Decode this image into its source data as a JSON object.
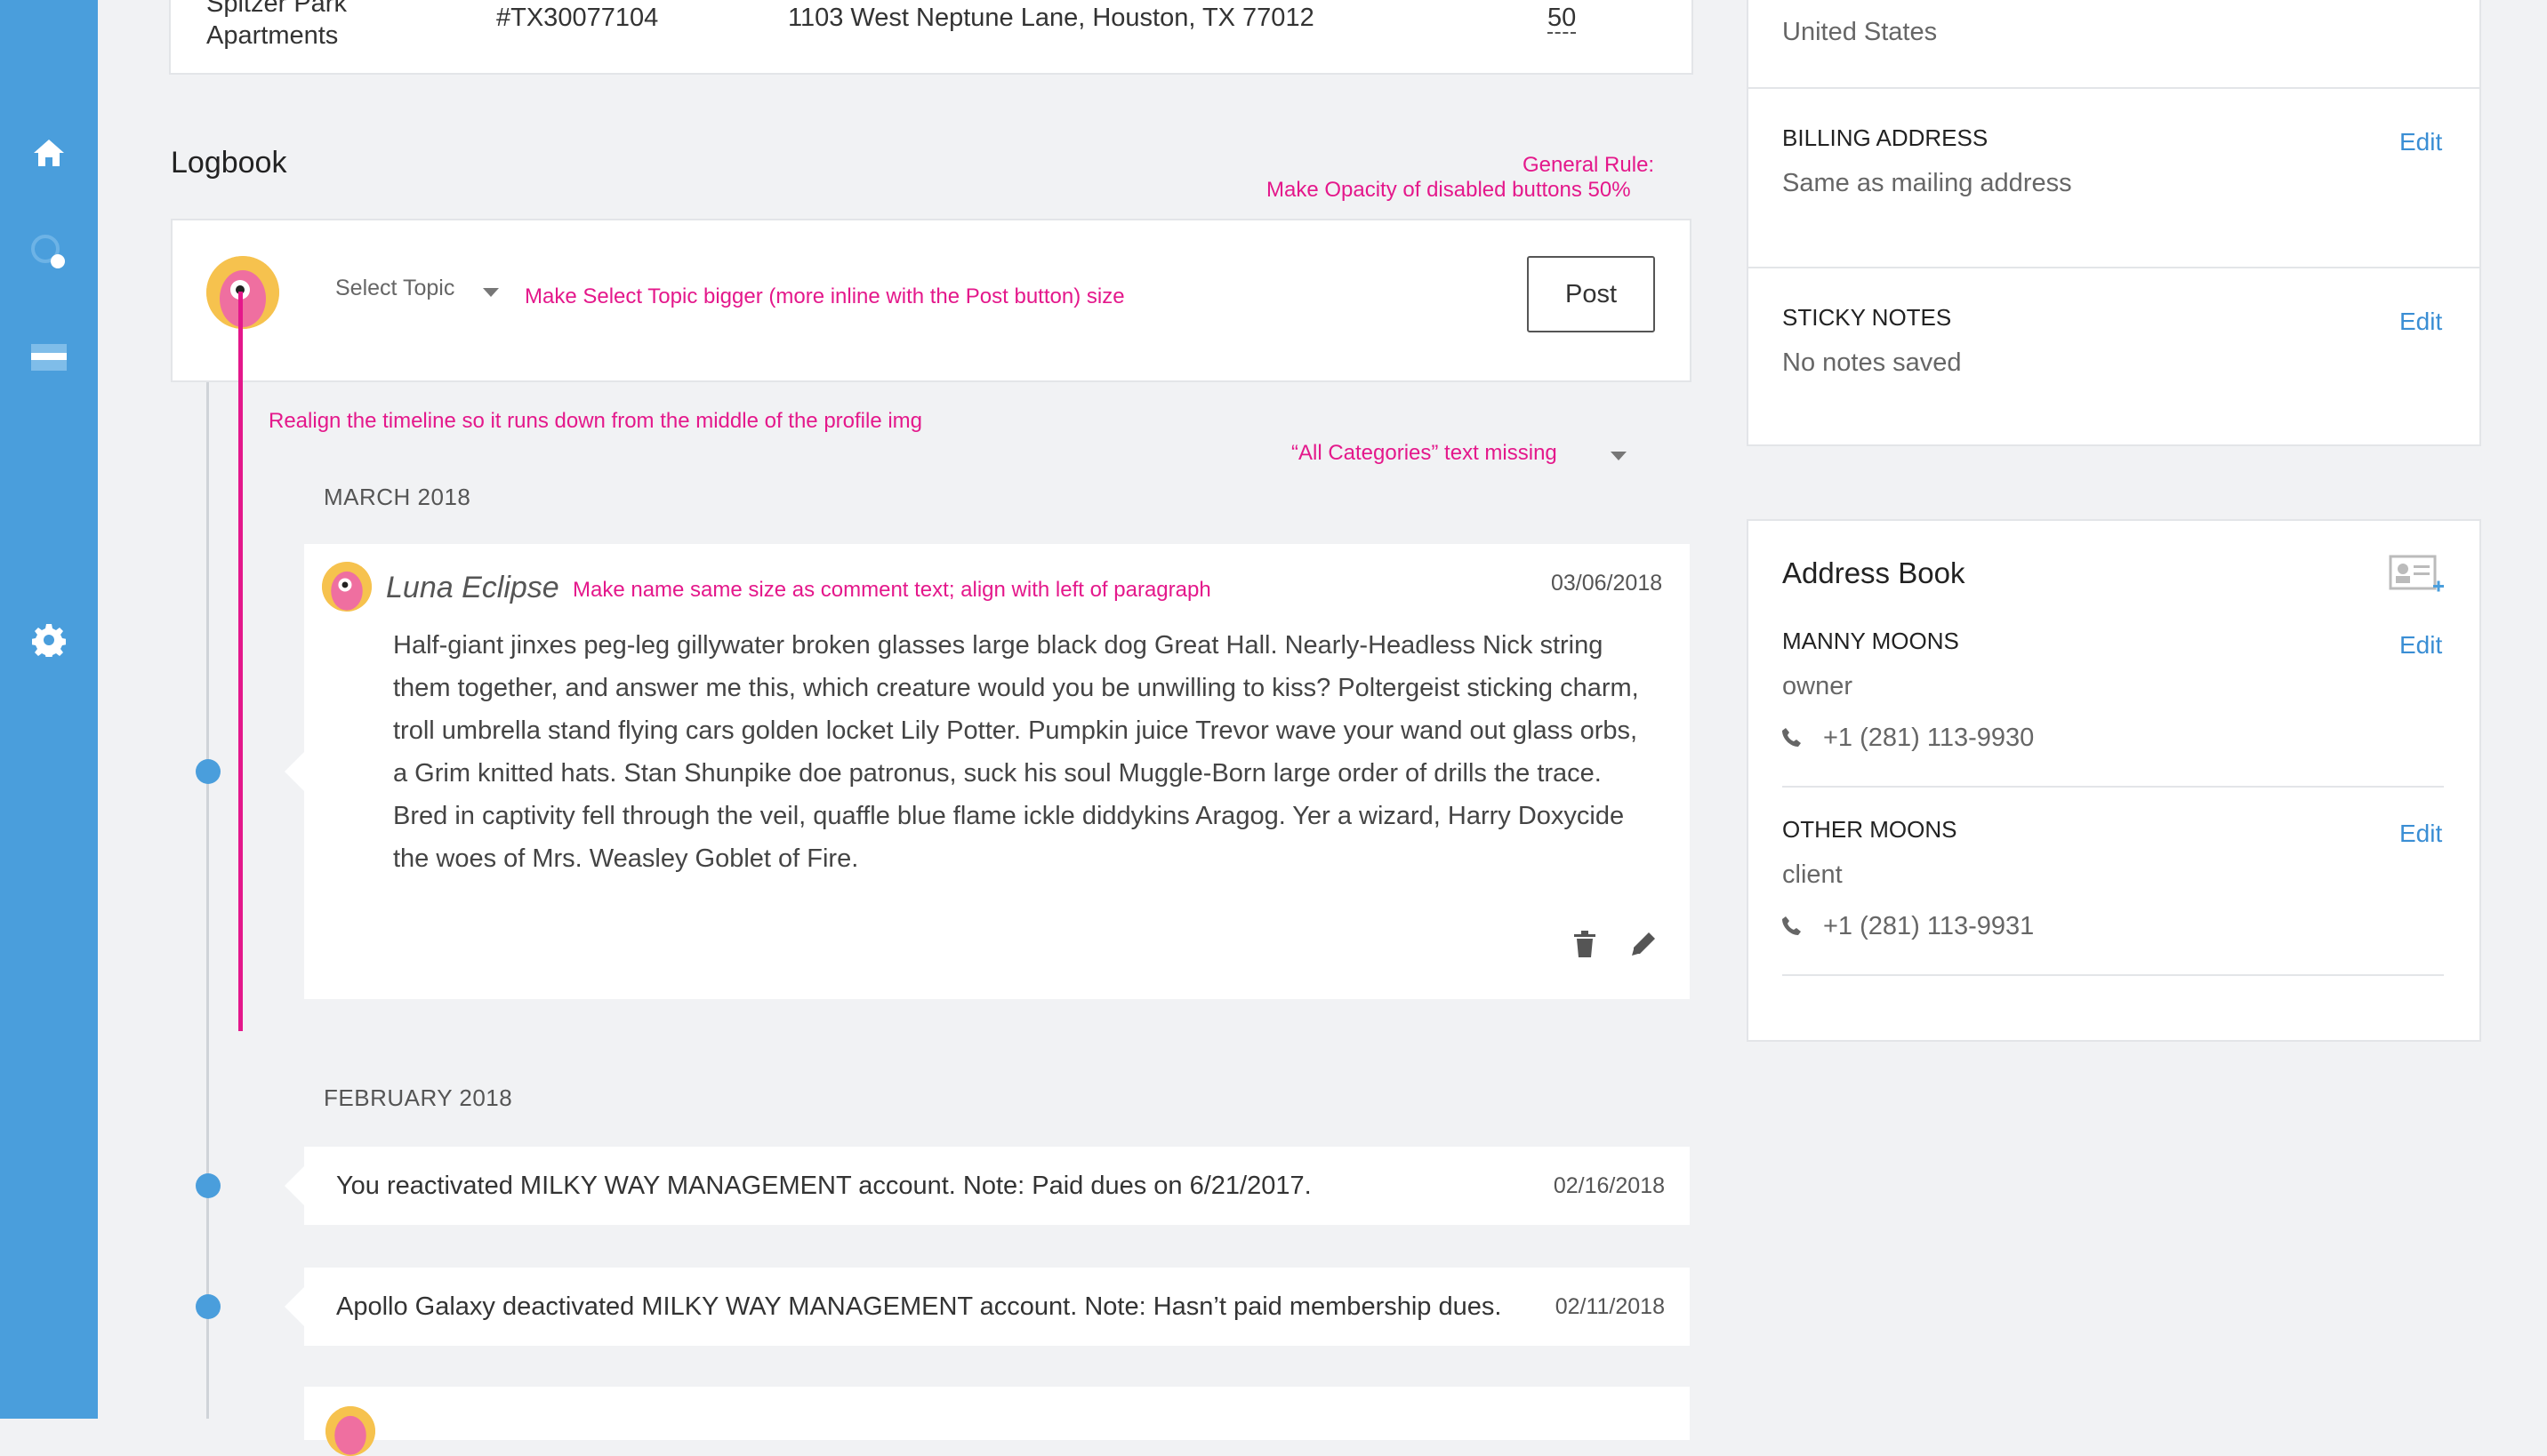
{
  "property_row": {
    "name_line1": "Spitzer Park",
    "name_line2": "Apartments",
    "id": "#TX30077104",
    "address": "1103 West Neptune Lane, Houston, TX 77012",
    "units": "50"
  },
  "logbook": {
    "title": "Logbook",
    "select_topic": "Select Topic",
    "post_label": "Post",
    "months": [
      "MARCH 2018",
      "FEBRUARY 2018"
    ],
    "post": {
      "author": "Luna Eclipse",
      "date": "03/06/2018",
      "body": "Half-giant jinxes peg-leg gillywater broken glasses large black dog Great Hall. Nearly-Headless Nick string them together, and answer me this, which creature would you be unwilling to kiss? Poltergeist sticking charm, troll umbrella stand flying cars golden locket Lily Potter. Pumpkin juice Trevor wave your wand out glass orbs, a Grim knitted hats. Stan Shunpike doe patronus, suck his soul Muggle-Born large order of drills the trace. Bred in captivity fell through the veil, quaffle blue flame ickle diddykins Aragog. Yer a wizard, Harry Doxycide the woes of Mrs. Weasley Goblet of Fire."
    },
    "entries": [
      {
        "text": "You reactivated MILKY WAY MANAGEMENT account. Note: Paid dues on 6/21/2017.",
        "date": "02/16/2018"
      },
      {
        "text": "Apollo Galaxy deactivated MILKY WAY MANAGEMENT account. Note: Hasn’t paid membership dues.",
        "date": "02/11/2018"
      }
    ]
  },
  "annotations": {
    "general_rule_1": "General Rule:",
    "general_rule_2": "Make Opacity of disabled buttons 50%",
    "select_topic_note": "Make Select Topic bigger (more inline with the Post button) size",
    "timeline_note": "Realign the timeline so it runs down from the middle of the profile img",
    "categories_note": "“All Categories” text missing",
    "name_note": "Make name same size as comment text; align with left of paragraph"
  },
  "account_panel": {
    "country": "United States",
    "billing_label": "BILLING ADDRESS",
    "billing_value": "Same as mailing address",
    "sticky_label": "STICKY NOTES",
    "sticky_value": "No notes saved",
    "edit_label": "Edit"
  },
  "address_book": {
    "title": "Address Book",
    "contacts": [
      {
        "name": "MANNY MOONS",
        "role": "owner",
        "phone": "+1 (281) 113-9930"
      },
      {
        "name": "OTHER MOONS",
        "role": "client",
        "phone": "+1 (281) 113-9931"
      }
    ],
    "edit_label": "Edit"
  },
  "colors": {
    "sidebar": "#4a9edc",
    "annotation": "#e4188b",
    "link": "#3a8ed4",
    "timeline_dot": "#4a9edc"
  },
  "icons": [
    "home-icon",
    "search-icon",
    "card-icon",
    "gear-icon",
    "trash-icon",
    "pencil-icon",
    "phone-icon",
    "add-contact-icon",
    "chevron-down-icon"
  ]
}
